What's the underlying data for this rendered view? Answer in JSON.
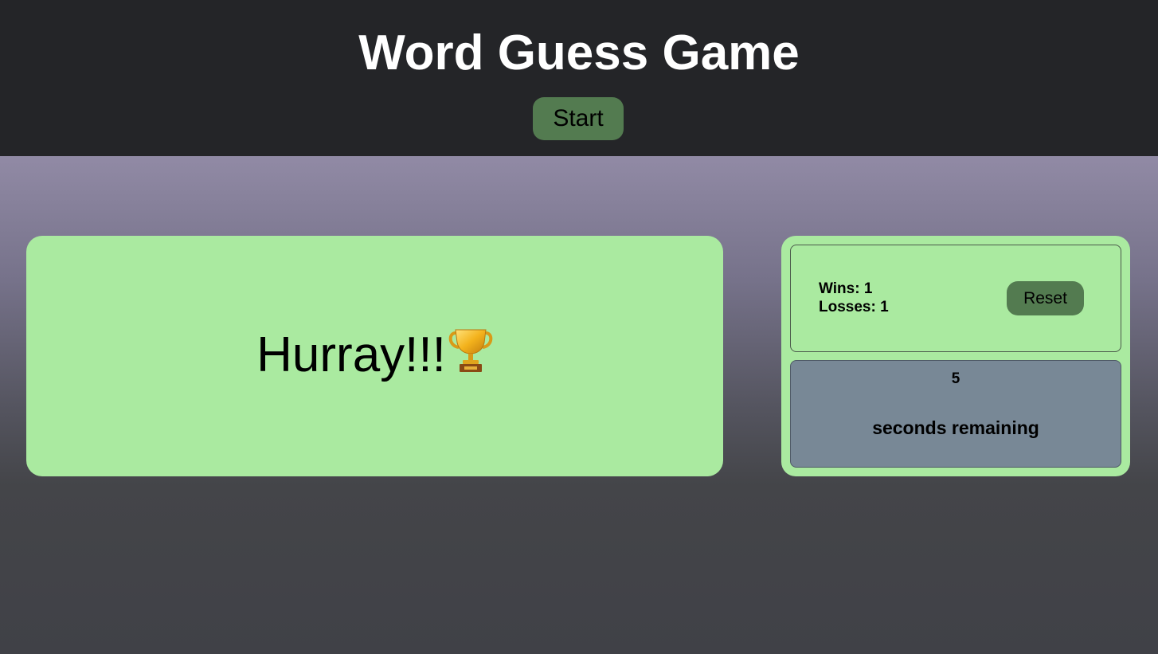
{
  "header": {
    "title": "Word Guess Game",
    "start_label": "Start"
  },
  "game": {
    "message": "Hurray!!!",
    "trophy_icon": "trophy-icon"
  },
  "score": {
    "wins": "Wins: 1",
    "losses": "Losses: 1",
    "reset_label": "Reset"
  },
  "timer": {
    "seconds": "5",
    "label": "seconds remaining"
  },
  "colors": {
    "header_bg": "#242528",
    "button_bg": "#537b50",
    "panel_bg": "#aaeaa0",
    "timer_bg": "#788896"
  }
}
